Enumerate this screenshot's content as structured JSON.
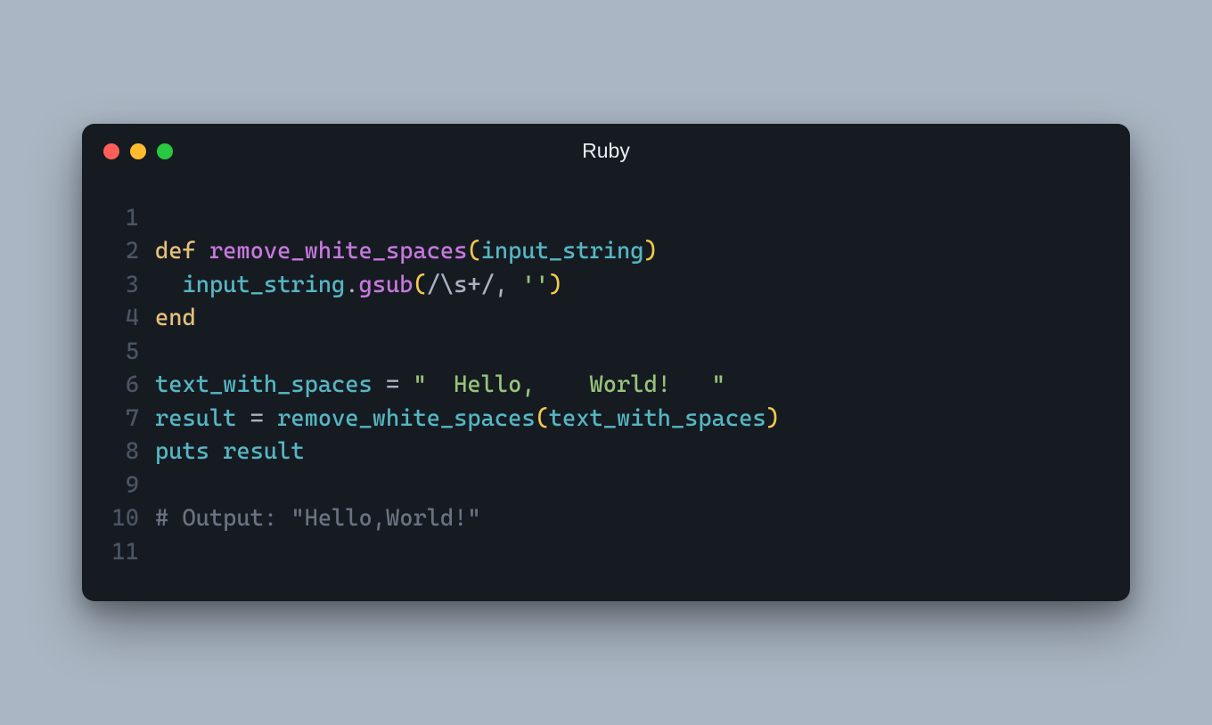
{
  "window": {
    "title": "Ruby",
    "traffic_lights": {
      "close": "close",
      "minimize": "minimize",
      "maximize": "maximize"
    }
  },
  "editor": {
    "lines": [
      {
        "num": "1",
        "tokens": []
      },
      {
        "num": "2",
        "tokens": [
          {
            "cls": "tok-kw",
            "text": "def"
          },
          {
            "cls": "",
            "text": " "
          },
          {
            "cls": "tok-fn",
            "text": "remove_white_spaces"
          },
          {
            "cls": "tok-paren",
            "text": "("
          },
          {
            "cls": "tok-param",
            "text": "input_string"
          },
          {
            "cls": "tok-paren",
            "text": ")"
          }
        ]
      },
      {
        "num": "3",
        "tokens": [
          {
            "cls": "",
            "text": "  "
          },
          {
            "cls": "tok-ident",
            "text": "input_string"
          },
          {
            "cls": "tok-punct",
            "text": "."
          },
          {
            "cls": "tok-call",
            "text": "gsub"
          },
          {
            "cls": "tok-paren",
            "text": "("
          },
          {
            "cls": "tok-regex",
            "text": "/\\s+/"
          },
          {
            "cls": "tok-punct",
            "text": ", "
          },
          {
            "cls": "tok-string",
            "text": "''"
          },
          {
            "cls": "tok-paren",
            "text": ")"
          }
        ]
      },
      {
        "num": "4",
        "tokens": [
          {
            "cls": "tok-kw",
            "text": "end"
          }
        ]
      },
      {
        "num": "5",
        "tokens": []
      },
      {
        "num": "6",
        "tokens": [
          {
            "cls": "tok-ident",
            "text": "text_with_spaces"
          },
          {
            "cls": "tok-op",
            "text": " = "
          },
          {
            "cls": "tok-string",
            "text": "\"  Hello,    World!   \""
          }
        ]
      },
      {
        "num": "7",
        "tokens": [
          {
            "cls": "tok-ident",
            "text": "result"
          },
          {
            "cls": "tok-op",
            "text": " = "
          },
          {
            "cls": "tok-ident",
            "text": "remove_white_spaces"
          },
          {
            "cls": "tok-paren",
            "text": "("
          },
          {
            "cls": "tok-ident",
            "text": "text_with_spaces"
          },
          {
            "cls": "tok-paren",
            "text": ")"
          }
        ]
      },
      {
        "num": "8",
        "tokens": [
          {
            "cls": "tok-ident",
            "text": "puts"
          },
          {
            "cls": "",
            "text": " "
          },
          {
            "cls": "tok-ident",
            "text": "result"
          }
        ]
      },
      {
        "num": "9",
        "tokens": []
      },
      {
        "num": "10",
        "tokens": [
          {
            "cls": "tok-comment",
            "text": "# Output: \"Hello,World!\""
          }
        ]
      },
      {
        "num": "11",
        "tokens": []
      }
    ]
  }
}
